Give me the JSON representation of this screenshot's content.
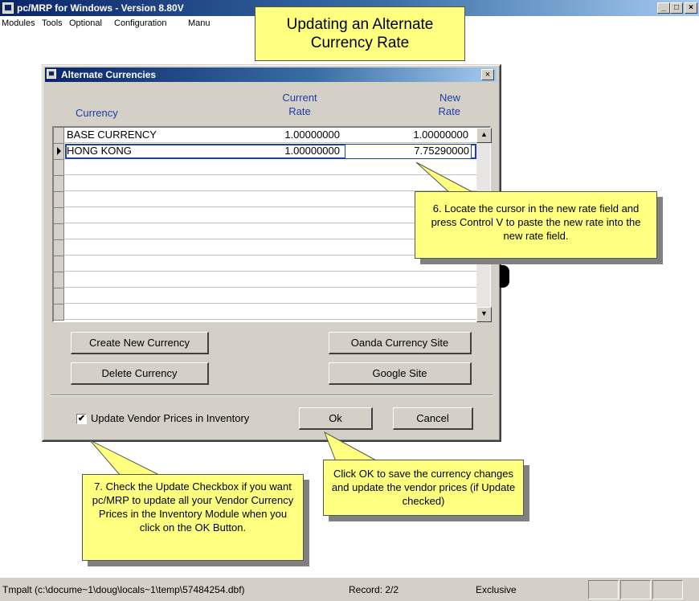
{
  "app": {
    "title": "pc/MRP for Windows - Version 8.80V",
    "caption_buttons": {
      "minimize": "_",
      "maximize": "□",
      "close": "×"
    }
  },
  "menu": [
    "Modules",
    "Tools",
    "Optional",
    "Configuration",
    "Manu"
  ],
  "title_callout": "Updating an Alternate Currency Rate",
  "dialog": {
    "title": "Alternate Currencies",
    "close_glyph": "×",
    "headers": {
      "currency": "Currency",
      "current_rate_line1": "Current",
      "current_rate_line2": "Rate",
      "new_rate_line1": "New",
      "new_rate_line2": "Rate"
    },
    "rows": [
      {
        "currency": "BASE CURRENCY",
        "current_rate": "1.00000000",
        "new_rate": "1.00000000"
      },
      {
        "currency": "HONG KONG",
        "current_rate": "1.00000000",
        "new_rate": "7.75290000"
      }
    ],
    "buttons": {
      "create": "Create New Currency",
      "delete": "Delete Currency",
      "oanda": "Oanda Currency Site",
      "google": "Google Site",
      "ok": "Ok",
      "cancel": "Cancel"
    },
    "checkbox": {
      "label": "Update Vendor Prices in Inventory",
      "checked": true,
      "mark": "✔"
    }
  },
  "callouts": {
    "step6": "6. Locate the cursor in the new rate field and press Control V to paste the new rate into the new rate field.",
    "step7": "7. Check the Update Checkbox if you want pc/MRP to update all your Vendor Currency Prices in the Inventory Module when you click on the OK Button.",
    "ok": "Click OK to save the currency changes and update the vendor prices (if Update checked)"
  },
  "status": {
    "file": "Tmpalt (c:\\docume~1\\doug\\locals~1\\temp\\57484254.dbf)",
    "record": "Record: 2/2",
    "mode": "Exclusive"
  },
  "colors": {
    "header_text": "#1b3ea8",
    "callout_bg": "#ffff80",
    "title_bar": "#0a246a"
  }
}
